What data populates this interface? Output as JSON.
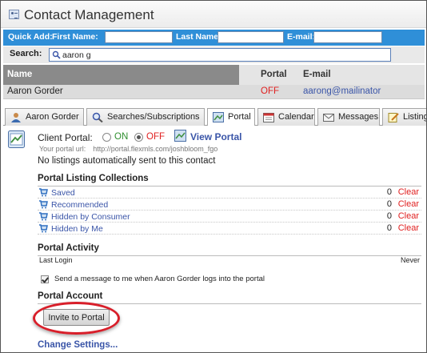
{
  "header": {
    "title": "Contact Management"
  },
  "quick_add": {
    "label": "Quick Add:",
    "first_name_label": "First Name:",
    "last_name_label": "Last Name:",
    "email_label": "E-mail:",
    "first_name_value": "",
    "last_name_value": "",
    "email_value": ""
  },
  "search": {
    "label": "Search:",
    "value": "aaron g"
  },
  "results": {
    "columns": {
      "name": "Name",
      "portal": "Portal",
      "email": "E-mail"
    },
    "rows": [
      {
        "name": "Aaron Gorder",
        "portal": "OFF",
        "email": "aarong@mailinator"
      }
    ]
  },
  "tabs": [
    {
      "label": "Aaron Gorder",
      "icon": "person-icon"
    },
    {
      "label": "Searches/Subscriptions",
      "icon": "magnifier-icon"
    },
    {
      "label": "Portal",
      "icon": "portal-icon",
      "active": true
    },
    {
      "label": "Calendar",
      "icon": "calendar-icon"
    },
    {
      "label": "Messages",
      "icon": "envelope-icon"
    },
    {
      "label": "Listings",
      "icon": "pencil-icon"
    }
  ],
  "portal": {
    "client_portal_label": "Client Portal:",
    "on_label": "ON",
    "off_label": "OFF",
    "selected": "OFF",
    "view_portal_label": "View Portal",
    "url_label": "Your portal url:",
    "url_value": "http://portal.flexmls.com/joshbloom_fgo",
    "no_listings_text": "No listings automatically sent to this contact"
  },
  "collections": {
    "title": "Portal Listing Collections",
    "items": [
      {
        "label": "Saved",
        "count": "0",
        "action": "Clear"
      },
      {
        "label": "Recommended",
        "count": "0",
        "action": "Clear"
      },
      {
        "label": "Hidden by Consumer",
        "count": "0",
        "action": "Clear"
      },
      {
        "label": "Hidden by Me",
        "count": "0",
        "action": "Clear"
      }
    ]
  },
  "activity": {
    "title": "Portal Activity",
    "last_login_label": "Last Login",
    "last_login_value": "Never",
    "notify_label": "Send a message to me when Aaron Gorder logs into the portal",
    "notify_checked": true
  },
  "account": {
    "title": "Portal Account",
    "invite_button": "Invite to Portal",
    "change_settings": "Change Settings..."
  },
  "colors": {
    "quick_add_bar": "#2f8fd8",
    "link": "#3a55a8",
    "off_red": "#e02020",
    "highlight_ring": "#d81f2a",
    "header_gray": "#8a8a8a"
  }
}
